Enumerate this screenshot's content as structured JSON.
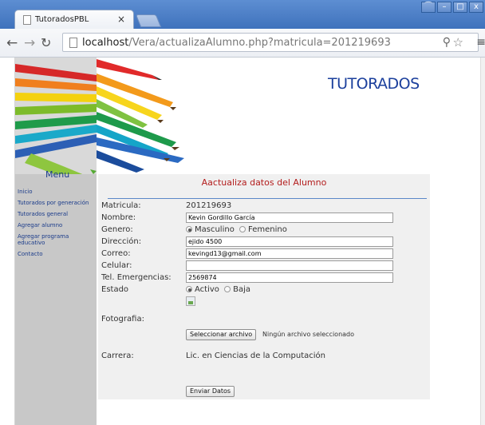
{
  "browser": {
    "tab_title": "TutoradosPBL",
    "tab_close": "×",
    "url_host": "localhost",
    "url_path": "/Vera/actualizaAlumno.php?matricula=201219693"
  },
  "sidebar": {
    "menu_title": "Menu",
    "items": [
      {
        "label": "Inicio"
      },
      {
        "label": "Tutorados por generación"
      },
      {
        "label": "Tutorados general"
      },
      {
        "label": "Agregar alumno"
      },
      {
        "label": "Agregar programa educativo"
      },
      {
        "label": "Contacto"
      }
    ]
  },
  "header": {
    "title": "TUTORADOS"
  },
  "form": {
    "title": "Aactualiza datos del Alumno",
    "matricula": {
      "label": "Matricula:",
      "value": "201219693"
    },
    "nombre": {
      "label": "Nombre:",
      "value": "Kevin Gordillo García"
    },
    "genero": {
      "label": "Genero:",
      "opt1": "Masculino",
      "opt2": "Femenino",
      "selected": "Masculino"
    },
    "direccion": {
      "label": "Dirección:",
      "value": "ejido 4500"
    },
    "correo": {
      "label": "Correo:",
      "value": "kevingd13@gmail.com"
    },
    "celular": {
      "label": "Celular:",
      "value": ""
    },
    "tel_emergencias": {
      "label": "Tel. Emergencias:",
      "value": "2569874"
    },
    "estado": {
      "label": "Estado",
      "opt1": "Activo",
      "opt2": "Baja",
      "selected": "Activo"
    },
    "fotografia": {
      "label": "Fotografia:",
      "button": "Seleccionar archivo",
      "note": "Ningún archivo seleccionado"
    },
    "carrera": {
      "label": "Carrera:",
      "value": "Lic. en Ciencias de la Computación"
    },
    "submit": "Enviar Datos"
  }
}
